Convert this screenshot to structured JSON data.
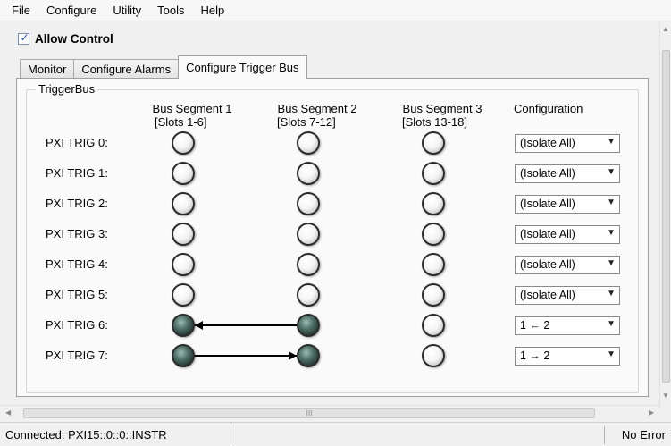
{
  "menubar": {
    "items": [
      "File",
      "Configure",
      "Utility",
      "Tools",
      "Help"
    ]
  },
  "allow_control": {
    "label": "Allow Control",
    "checked": true
  },
  "tabs": [
    {
      "label": "Monitor",
      "active": false
    },
    {
      "label": "Configure Alarms",
      "active": false
    },
    {
      "label": "Configure Trigger Bus",
      "active": true
    }
  ],
  "group": {
    "title": "TriggerBus",
    "columns": [
      {
        "line1": "Bus Segment 1",
        "line2": "[Slots 1-6]"
      },
      {
        "line1": "Bus Segment 2",
        "line2": "[Slots 7-12]"
      },
      {
        "line1": "Bus Segment 3",
        "line2": "[Slots 13-18]"
      },
      {
        "line1": "Configuration",
        "line2": ""
      }
    ],
    "rows": [
      {
        "label": "PXI TRIG 0:",
        "leds": [
          false,
          false,
          false
        ],
        "config": "(Isolate All)"
      },
      {
        "label": "PXI TRIG 1:",
        "leds": [
          false,
          false,
          false
        ],
        "config": "(Isolate All)"
      },
      {
        "label": "PXI TRIG 2:",
        "leds": [
          false,
          false,
          false
        ],
        "config": "(Isolate All)"
      },
      {
        "label": "PXI TRIG 3:",
        "leds": [
          false,
          false,
          false
        ],
        "config": "(Isolate All)"
      },
      {
        "label": "PXI TRIG 4:",
        "leds": [
          false,
          false,
          false
        ],
        "config": "(Isolate All)"
      },
      {
        "label": "PXI TRIG 5:",
        "leds": [
          false,
          false,
          false
        ],
        "config": "(Isolate All)"
      },
      {
        "label": "PXI TRIG 6:",
        "leds": [
          true,
          true,
          false
        ],
        "config": "1 ← 2",
        "route": "2-to-1"
      },
      {
        "label": "PXI TRIG 7:",
        "leds": [
          true,
          true,
          false
        ],
        "config": "1 → 2",
        "route": "1-to-2"
      }
    ]
  },
  "icons": {
    "dropdown": "chevron-down-icon",
    "checkbox": "check-icon"
  },
  "hscroll_grip": "III",
  "status": {
    "connection": "Connected: PXI15::0::0::INSTR",
    "error": "No Error"
  },
  "colors": {
    "led_off": "#f5f5f5",
    "led_on": "#3f5c55",
    "panel_bg": "#fafafa"
  }
}
